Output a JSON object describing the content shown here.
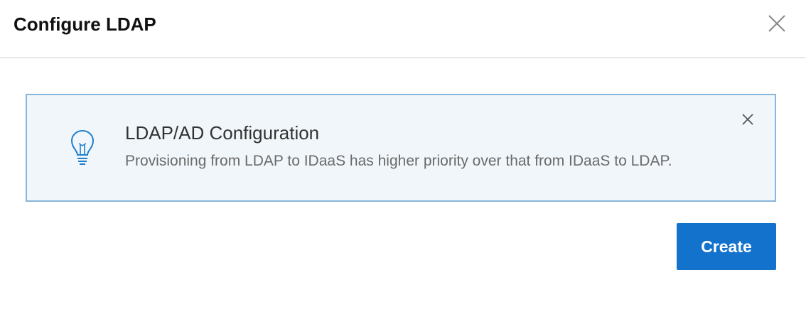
{
  "dialog": {
    "title": "Configure LDAP",
    "close_icon": "close-icon"
  },
  "alert": {
    "icon": "lightbulb-icon",
    "title": "LDAP/AD Configuration",
    "description": "Provisioning from LDAP to IDaaS has higher priority over that from IDaaS to LDAP.",
    "close_icon": "close-icon",
    "background_color": "#f1f6fa",
    "border_color": "#88b6dc",
    "icon_color": "#1e7fd0"
  },
  "actions": {
    "create_label": "Create",
    "create_color": "#1272cc"
  }
}
